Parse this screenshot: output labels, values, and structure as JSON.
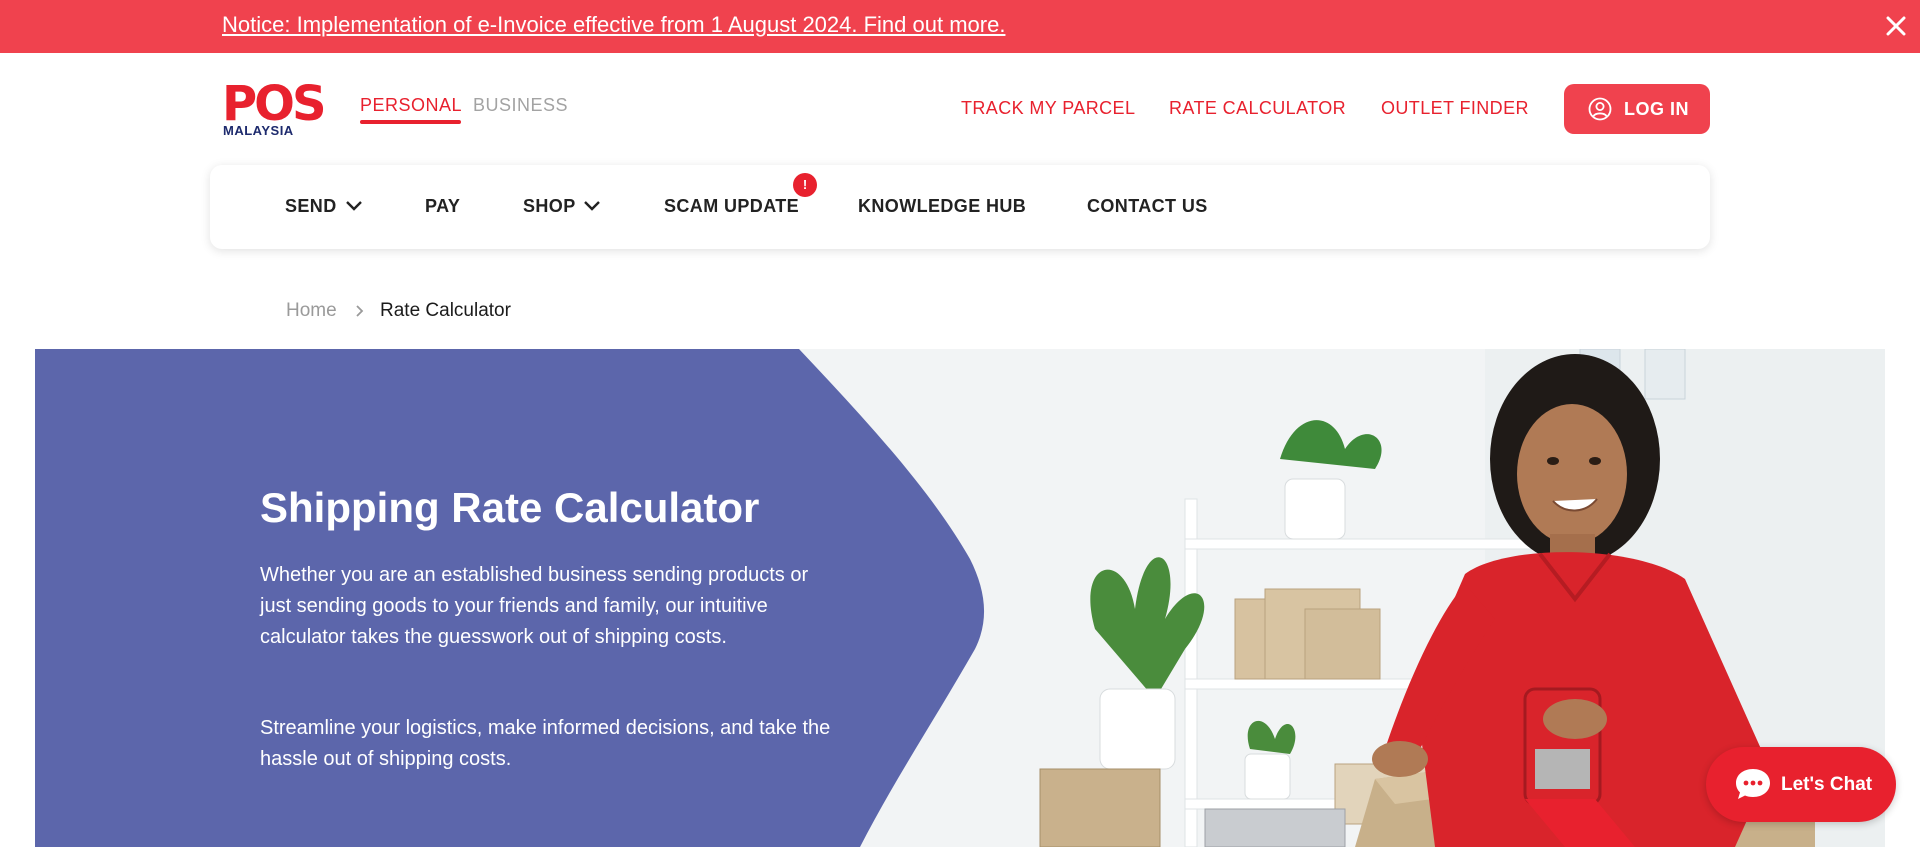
{
  "notice": {
    "text": "Notice: Implementation of e-Invoice effective from 1 August 2024. Find out more."
  },
  "brand": {
    "logo_text": "POS",
    "logo_sub": "MALAYSIA",
    "primary_color": "#e8212e",
    "notice_color": "#f0424e",
    "hero_color": "#5c66ab"
  },
  "segments": {
    "personal": "PERSONAL",
    "business": "BUSINESS",
    "selected": "PERSONAL"
  },
  "top_links": {
    "track": "TRACK MY PARCEL",
    "rate": "RATE CALCULATOR",
    "outlet": "OUTLET FINDER",
    "login": "LOG IN"
  },
  "main_nav": {
    "send": "SEND",
    "pay": "PAY",
    "shop": "SHOP",
    "scam_update": "SCAM UPDATE",
    "scam_badge": "!",
    "knowledge_hub": "KNOWLEDGE HUB",
    "contact_us": "CONTACT US"
  },
  "breadcrumb": {
    "home": "Home",
    "current": "Rate Calculator"
  },
  "hero": {
    "title": "Shipping Rate Calculator",
    "paragraph1": "Whether you are an established business sending products or just sending goods to your friends and family, our intuitive calculator takes the guesswork out of shipping costs.",
    "paragraph2": "Streamline your logistics, make informed decisions, and take the hassle out of shipping costs."
  },
  "chat": {
    "label": "Let's Chat"
  },
  "icons": {
    "close": "close-icon",
    "user": "user-circle-icon",
    "chevron": "chevron-down-icon",
    "breadcrumb_separator": "chevron-right-icon",
    "chat": "chat-bubble-icon"
  }
}
